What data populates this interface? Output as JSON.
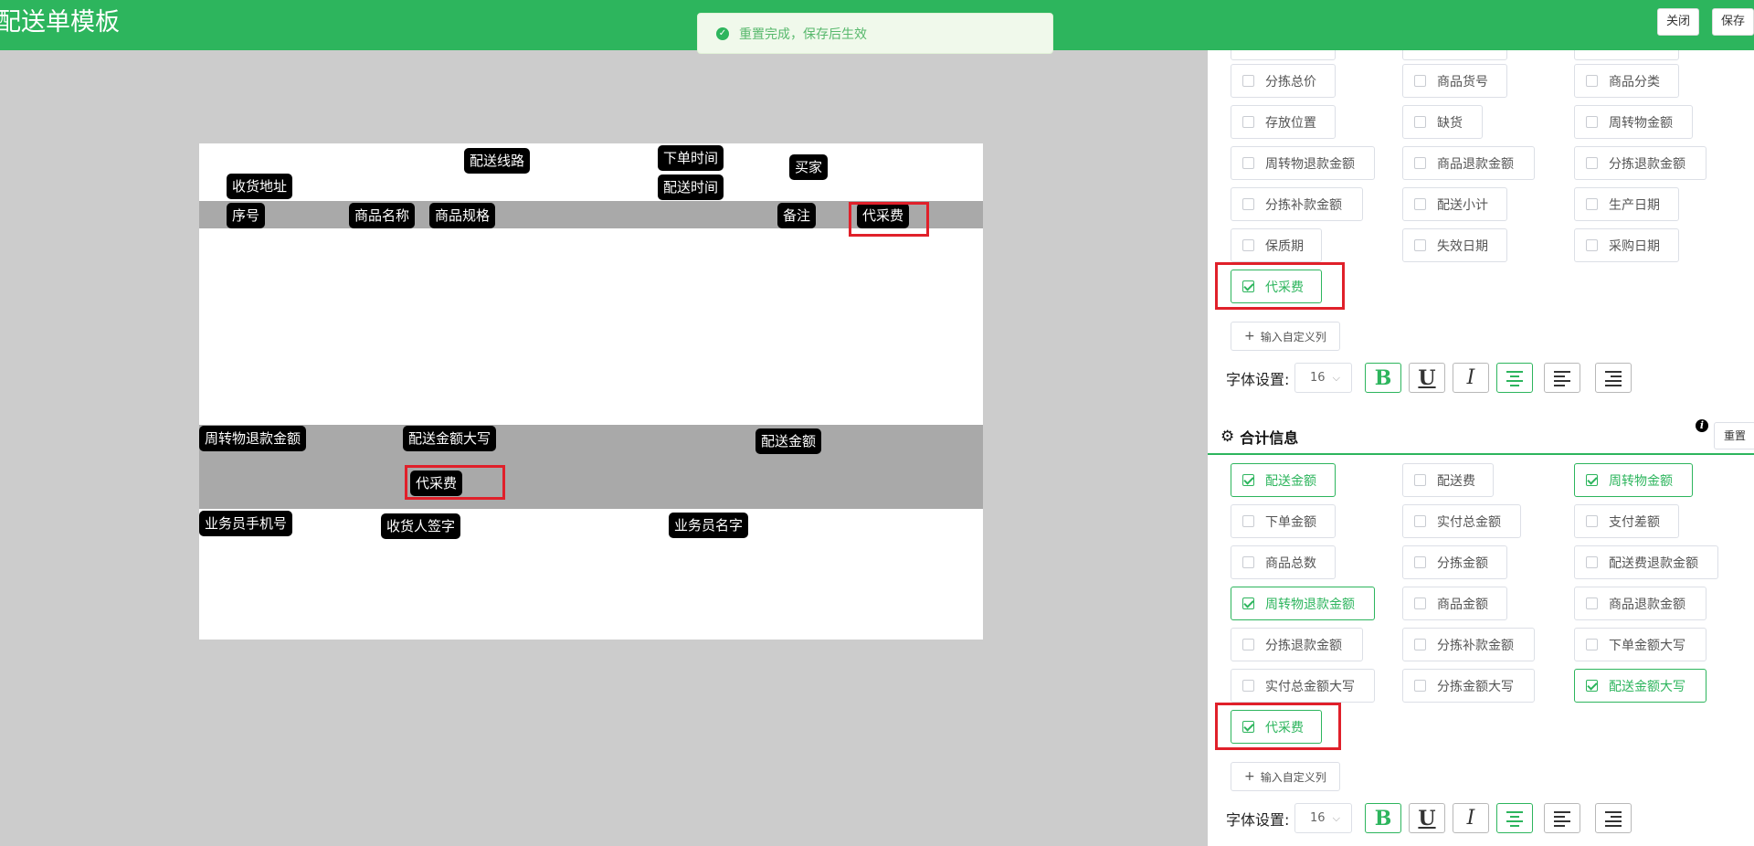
{
  "header": {
    "title": "配送单模板",
    "close_label": "关闭",
    "save_label": "保存"
  },
  "toast": {
    "message": "重置完成，保存后生效"
  },
  "canvas": {
    "top_fields": [
      "收货地址",
      "配送线路",
      "下单时间",
      "配送时间",
      "买家"
    ],
    "table_columns": [
      "序号",
      "商品名称",
      "商品规格",
      "备注",
      "代采费"
    ],
    "footer_fields": [
      "周转物退款金额",
      "配送金额大写",
      "配送金额",
      "代采费"
    ],
    "bottom_fields": [
      "业务员手机号",
      "收货人签字",
      "业务员名字"
    ]
  },
  "product_columns": {
    "options": [
      {
        "label": "分拣总价",
        "checked": false
      },
      {
        "label": "商品货号",
        "checked": false
      },
      {
        "label": "商品分类",
        "checked": false
      },
      {
        "label": "存放位置",
        "checked": false
      },
      {
        "label": "缺货",
        "checked": false
      },
      {
        "label": "周转物金额",
        "checked": false
      },
      {
        "label": "周转物退款金额",
        "checked": false
      },
      {
        "label": "商品退款金额",
        "checked": false
      },
      {
        "label": "分拣退款金额",
        "checked": false
      },
      {
        "label": "分拣补款金额",
        "checked": false
      },
      {
        "label": "配送小计",
        "checked": false
      },
      {
        "label": "生产日期",
        "checked": false
      },
      {
        "label": "保质期",
        "checked": false
      },
      {
        "label": "失效日期",
        "checked": false
      },
      {
        "label": "采购日期",
        "checked": false
      },
      {
        "label": "代采费",
        "checked": true
      }
    ],
    "add_custom_label": "输入自定义列",
    "font_label": "字体设置:",
    "font_size": "16"
  },
  "summary": {
    "title": "合计信息",
    "reset_label": "重置",
    "options": [
      {
        "label": "配送金额",
        "checked": true
      },
      {
        "label": "配送费",
        "checked": false
      },
      {
        "label": "周转物金额",
        "checked": true
      },
      {
        "label": "下单金额",
        "checked": false
      },
      {
        "label": "实付总金额",
        "checked": false
      },
      {
        "label": "支付差额",
        "checked": false
      },
      {
        "label": "商品总数",
        "checked": false
      },
      {
        "label": "分拣金额",
        "checked": false
      },
      {
        "label": "配送费退款金额",
        "checked": false
      },
      {
        "label": "周转物退款金额",
        "checked": true
      },
      {
        "label": "商品金额",
        "checked": false
      },
      {
        "label": "商品退款金额",
        "checked": false
      },
      {
        "label": "分拣退款金额",
        "checked": false
      },
      {
        "label": "分拣补款金额",
        "checked": false
      },
      {
        "label": "下单金额大写",
        "checked": false
      },
      {
        "label": "实付总金额大写",
        "checked": false
      },
      {
        "label": "分拣金额大写",
        "checked": false
      },
      {
        "label": "配送金额大写",
        "checked": true
      },
      {
        "label": "代采费",
        "checked": true
      }
    ],
    "add_custom_label": "输入自定义列",
    "font_label": "字体设置:",
    "font_size": "16"
  },
  "font_tools": {
    "bold": "B",
    "underline": "U",
    "italic": "I"
  },
  "colors": {
    "brand": "#2db55d",
    "highlight": "#e0202a"
  }
}
